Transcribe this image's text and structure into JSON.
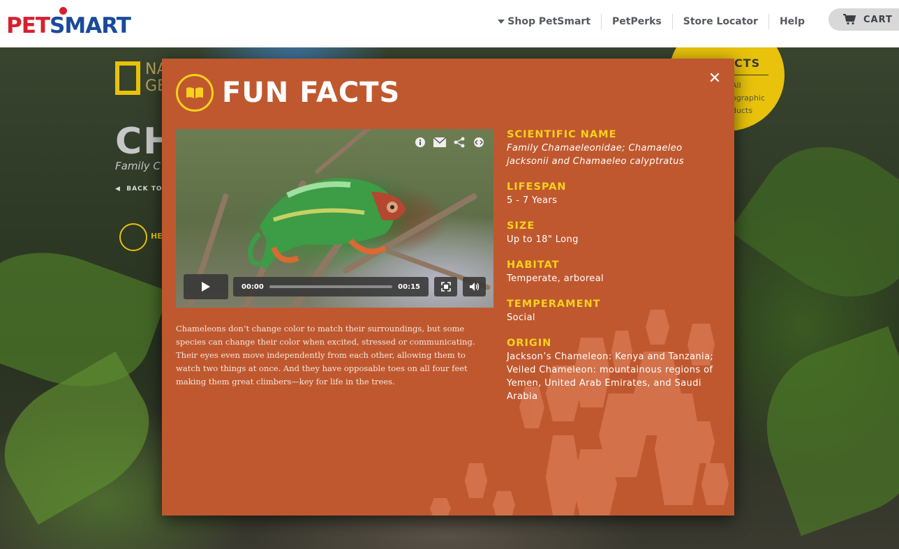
{
  "header": {
    "logo": {
      "part1": "PET",
      "part2": "SMART"
    },
    "nav": {
      "shop": "Shop PetSmart",
      "perks": "PetPerks",
      "store": "Store Locator",
      "help": "Help"
    },
    "cart": "CART"
  },
  "background": {
    "brand": "NA\nGE",
    "title": "CH",
    "subtitle": "Family C",
    "back": "BACK TO",
    "icon_label": "HE",
    "circle": {
      "title": "CTS",
      "links": "All\nographic\nducts"
    }
  },
  "modal": {
    "icon": "book-icon",
    "title": "FUN FACTS",
    "video": {
      "time_current": "00:00",
      "time_total": "00:15",
      "progress": 0
    },
    "description": "Chameleons don’t change color to match their surroundings, but some species can change their color when excited, stressed or communicating. Their eyes even move independently from each other, allowing them to watch two things at once. And they have opposable toes on all four feet making them great climbers—key for life in the trees.",
    "facts": [
      {
        "label": "SCIENTIFIC NAME",
        "value": "Family Chamaeleonidae; Chamaeleo jacksonii and Chamaeleo calyptratus"
      },
      {
        "label": "LIFESPAN",
        "value": "5 - 7 Years"
      },
      {
        "label": "SIZE",
        "value": "Up to 18\" Long"
      },
      {
        "label": "HABITAT",
        "value": "Temperate, arboreal"
      },
      {
        "label": "TEMPERAMENT",
        "value": "Social"
      },
      {
        "label": "ORIGIN",
        "value": "Jackson’s Chameleon: Kenya and Tanzania; Veiled Chameleon: mountainous regions of Yemen, United Arab Emirates, and Saudi Arabia"
      }
    ]
  },
  "colors": {
    "modal_bg": "#c0582f",
    "accent_yellow": "#f6d21b",
    "petsmart_red": "#d6202f",
    "petsmart_blue": "#1a4a9a"
  }
}
